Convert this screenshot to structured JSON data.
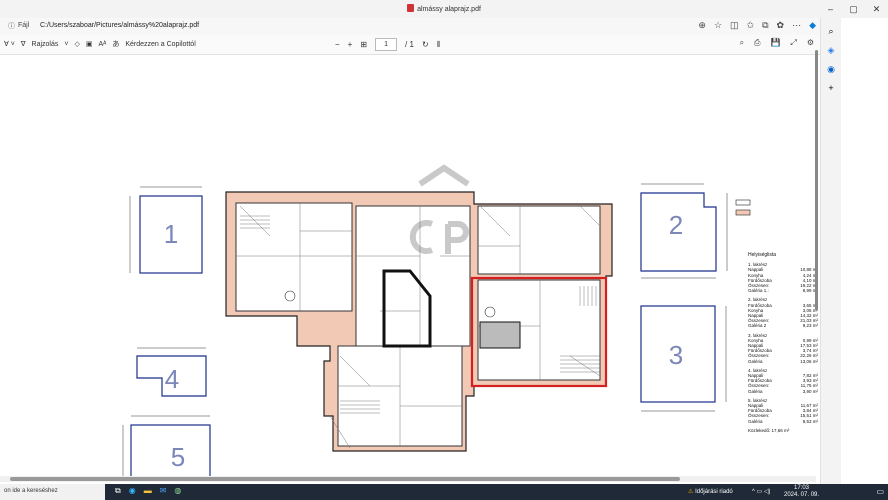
{
  "window": {
    "title": "almássy alaprajz.pdf",
    "minimize": "–",
    "maximize": "▢",
    "close": "✕"
  },
  "address": {
    "file_label": "Fájl",
    "url": "C:/Users/szaboar/Pictures/almássy%20alaprajz.pdf"
  },
  "pdf_toolbar": {
    "draw_label": "Rajzolás",
    "copilot_label": "Kérdezzen a Copilottól",
    "page_current": "1",
    "page_total": "/ 1",
    "minus": "−",
    "plus": "+"
  },
  "plan": {
    "apartments": [
      {
        "number": "1"
      },
      {
        "number": "2"
      },
      {
        "number": "3"
      },
      {
        "number": "4"
      },
      {
        "number": "5"
      }
    ],
    "legend": {
      "title": "Helyiséglista",
      "groups": [
        {
          "heading": "1. lakrész",
          "rows": [
            {
              "name": "Nappali",
              "value": "10,88 m²"
            },
            {
              "name": "Konyha",
              "value": "4,24 m²"
            },
            {
              "name": "Fürdőszoba",
              "value": "4,10 m²"
            },
            {
              "name": "Összesen:",
              "value": "19,22 m²"
            },
            {
              "name": "Galéria 1.:",
              "value": "8,99 m²"
            }
          ]
        },
        {
          "heading": "2. lakrész",
          "rows": [
            {
              "name": "Fürdőszoba",
              "value": "3,65 m²"
            },
            {
              "name": "Konyha",
              "value": "3,06 m²"
            },
            {
              "name": "Nappali",
              "value": "14,32 m²"
            },
            {
              "name": "Összesen:",
              "value": "21,03 m²"
            },
            {
              "name": "Galéria 2",
              "value": "9,23 m²"
            }
          ]
        },
        {
          "heading": "3. lakrész",
          "rows": [
            {
              "name": "Konyha",
              "value": "0,99 m²"
            },
            {
              "name": "Nappali",
              "value": "17,53 m²"
            },
            {
              "name": "Fürdőszoba",
              "value": "3,74 m²"
            },
            {
              "name": "Összesen:",
              "value": "22,26 m²"
            },
            {
              "name": "Galéria",
              "value": "13,06 m²"
            }
          ]
        },
        {
          "heading": "4. lakrész",
          "rows": [
            {
              "name": "Nappali",
              "value": "7,82 m²"
            },
            {
              "name": "Fürdőszoba",
              "value": "3,93 m²"
            },
            {
              "name": "Összesen:",
              "value": "11,75 m²"
            },
            {
              "name": "Galéria",
              "value": "3,90 m²"
            }
          ]
        },
        {
          "heading": "5. lakrész",
          "rows": [
            {
              "name": "Nappali",
              "value": "11,67 m²"
            },
            {
              "name": "Fürdőszoba",
              "value": "3,84 m²"
            },
            {
              "name": "Összesen:",
              "value": "15,51 m²"
            },
            {
              "name": "Galéria",
              "value": "9,53 m²"
            }
          ]
        }
      ],
      "footer": "Közlekedő: 17,66 m²"
    }
  },
  "taskbar": {
    "search_placeholder": "on ide a kereséshez",
    "weather": "Időjárási riadó",
    "time": "17:03",
    "date": "2024. 07. 09."
  },
  "colors": {
    "highlight": "#d42020",
    "wall_fill": "#f2c9b4",
    "wall_line": "#222222"
  }
}
